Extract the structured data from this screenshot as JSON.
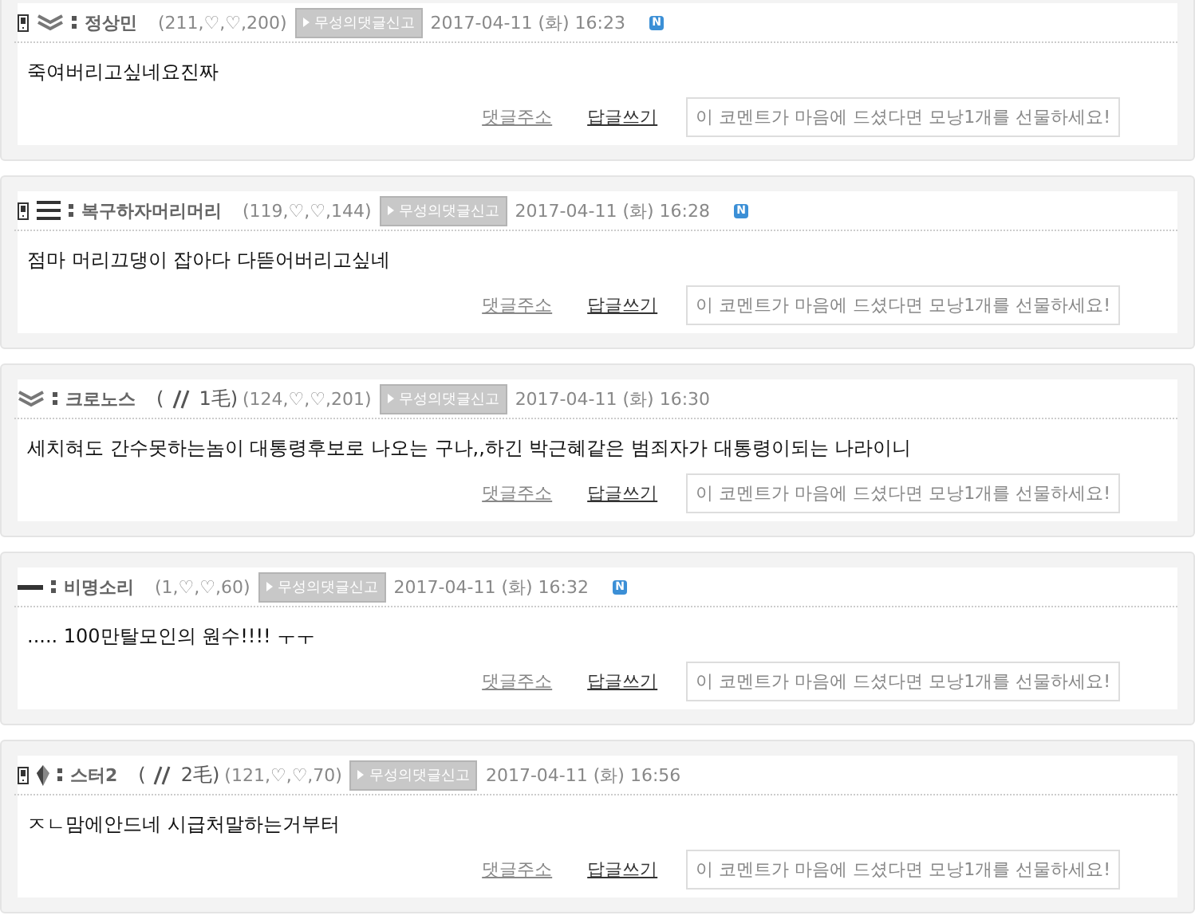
{
  "comments": [
    {
      "mobile": true,
      "kind": "chevrons",
      "nick": "정상민",
      "stats": "(211,♡,♡,200)",
      "report": "무성의댓글신고",
      "date": "2017-04-11 (화) 16:23",
      "new_badge": "N",
      "body": "죽여버리고싶네요진짜",
      "link_address": "댓글주소",
      "link_reply": "답글쓰기",
      "gift": "이 코멘트가 마음에 드셨다면 모낭1개를 선물하세요!"
    },
    {
      "mobile": true,
      "kind": "bars",
      "nick": "복구하자머리머리",
      "stats": "(119,♡,♡,144)",
      "report": "무성의댓글신고",
      "date": "2017-04-11 (화) 16:28",
      "new_badge": "N",
      "body": "점마 머리끄댕이 잡아다 다뜯어버리고싶네",
      "link_address": "댓글주소",
      "link_reply": "답글쓰기",
      "gift": "이 코멘트가 마음에 드셨다면 모낭1개를 선물하세요!"
    },
    {
      "mobile": false,
      "kind": "chevrons",
      "nick": "크로노스",
      "hair": {
        "open": "(",
        "label": "1毛)"
      },
      "stats": "(124,♡,♡,201)",
      "report": "무성의댓글신고",
      "date": "2017-04-11 (화) 16:30",
      "body": "세치혀도 간수못하는놈이 대통령후보로 나오는 구나,,하긴 박근혜같은 범죄자가 대통령이되는 나라이니",
      "link_address": "댓글주소",
      "link_reply": "답글쓰기",
      "gift": "이 코멘트가 마음에 드셨다면 모낭1개를 선물하세요!"
    },
    {
      "mobile": false,
      "kind": "dash",
      "nick": "비명소리",
      "stats": "(1,♡,♡,60)",
      "report": "무성의댓글신고",
      "date": "2017-04-11 (화) 16:32",
      "new_badge": "N",
      "body": "..... 100만탈모인의 원수!!!! ㅜㅜ",
      "link_address": "댓글주소",
      "link_reply": "답글쓰기",
      "gift": "이 코멘트가 마음에 드셨다면 모낭1개를 선물하세요!"
    },
    {
      "mobile": true,
      "kind": "diamond",
      "nick": "스터2",
      "hair": {
        "open": "(",
        "label": "2毛)"
      },
      "stats": "(121,♡,♡,70)",
      "report": "무성의댓글신고",
      "date": "2017-04-11 (화) 16:56",
      "body": "ㅈㄴ맘에안드네 시급처말하는거부터",
      "link_address": "댓글주소",
      "link_reply": "답글쓰기",
      "gift": "이 코멘트가 마음에 드셨다면 모낭1개를 선물하세요!"
    }
  ]
}
